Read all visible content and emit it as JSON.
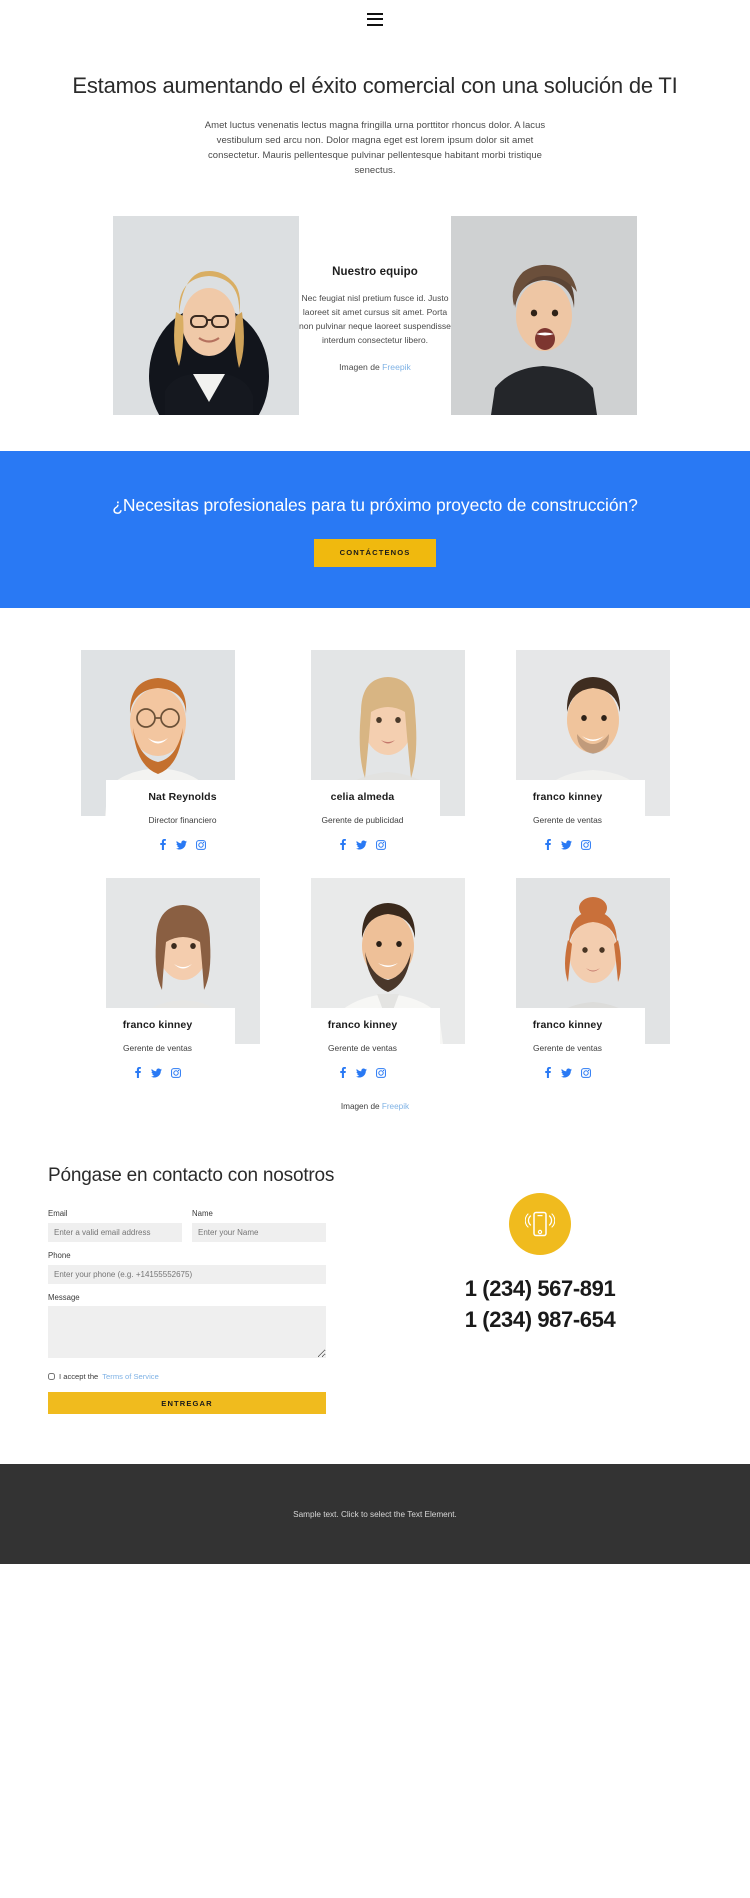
{
  "header": {
    "menu_icon": "hamburger-menu-icon"
  },
  "hero": {
    "title": "Estamos aumentando el éxito comercial con una solución de TI",
    "lead": "Amet luctus venenatis lectus magna fringilla urna porttitor rhoncus dolor. A lacus vestibulum sed arcu non. Dolor magna eget est lorem ipsum dolor sit amet consectetur. Mauris pellentesque pulvinar pellentesque habitant morbi tristique senectus."
  },
  "intro": {
    "heading": "Nuestro equipo",
    "body": "Nec feugiat nisl pretium fusce id. Justo laoreet sit amet cursus sit amet. Porta non pulvinar neque laoreet suspendisse interdum consectetur libero.",
    "credit_prefix": "Imagen de ",
    "credit_link": "Freepik",
    "left_photo_alt": "blonde-businesswoman-with-glasses-photo",
    "right_photo_alt": "laughing-young-man-photo"
  },
  "cta": {
    "title": "¿Necesitas profesionales para tu próximo proyecto de construcción?",
    "button": "CONTÁCTENOS",
    "bg_color": "#2979f4",
    "button_color": "#f0b90e"
  },
  "team": {
    "members": [
      {
        "name": "Nat Reynolds",
        "role": "Director financiero",
        "photo_alt": "bearded-man-with-glasses-photo"
      },
      {
        "name": "celia almeda",
        "role": "Gerente de publicidad",
        "photo_alt": "blonde-young-woman-photo"
      },
      {
        "name": "franco kinney",
        "role": "Gerente de ventas",
        "photo_alt": "smiling-short-hair-man-photo"
      },
      {
        "name": "franco kinney",
        "role": "Gerente de ventas",
        "photo_alt": "brunette-bob-woman-photo"
      },
      {
        "name": "franco kinney",
        "role": "Gerente de ventas",
        "photo_alt": "bearded-man-white-shirt-photo"
      },
      {
        "name": "franco kinney",
        "role": "Gerente de ventas",
        "photo_alt": "redhead-woman-bun-photo"
      }
    ],
    "social_icons": [
      "facebook-icon",
      "twitter-icon",
      "instagram-icon"
    ],
    "social_color": "#2979f4",
    "credit_prefix": "Imagen de ",
    "credit_link": "Freepik"
  },
  "contact": {
    "title": "Póngase en contacto con nosotros",
    "fields": {
      "email_label": "Email",
      "email_placeholder": "Enter a valid email address",
      "name_label": "Name",
      "name_placeholder": "Enter your Name",
      "phone_label": "Phone",
      "phone_placeholder": "Enter your phone (e.g. +14155552675)",
      "message_label": "Message",
      "message_placeholder": ""
    },
    "accept_text": "I accept the ",
    "terms_link": "Terms of Service",
    "submit_label": "ENTREGAR",
    "phone_numbers": [
      "1 (234) 567-891",
      "1 (234) 987-654"
    ],
    "badge_icon": "mobile-phone-ringing-icon",
    "badge_color": "#f0bb1e"
  },
  "footer": {
    "text": "Sample text. Click to select the Text Element."
  }
}
